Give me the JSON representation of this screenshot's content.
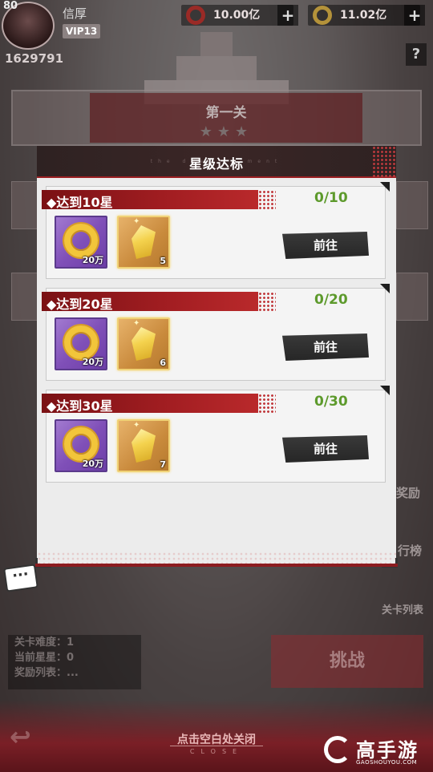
{
  "player": {
    "level": "80",
    "name": "信厚",
    "vip": "VIP13",
    "power": "1629791"
  },
  "resources": [
    {
      "icon": "ruby-coin-icon",
      "value": "10.00亿"
    },
    {
      "icon": "gold-coin-icon",
      "value": "11.02亿"
    }
  ],
  "background": {
    "stage_title": "第一关",
    "stage_stars": "★★★",
    "side_labels": [
      "奖励",
      "行榜",
      "关卡列表"
    ],
    "info_lines": [
      "关卡难度：1",
      "当前星星：0",
      "奖励列表：..."
    ],
    "challenge_label": "挑战"
  },
  "modal": {
    "title": "星级达标",
    "subtitle": "the deep ferment",
    "rows": [
      {
        "label": "◆达到10星",
        "progress": "0/10",
        "items": [
          {
            "icon": "gold-ring-icon",
            "qty": "20万"
          },
          {
            "icon": "gold-crystal-icon",
            "qty": "5"
          }
        ],
        "button": "前往"
      },
      {
        "label": "◆达到20星",
        "progress": "0/20",
        "items": [
          {
            "icon": "gold-ring-icon",
            "qty": "20万"
          },
          {
            "icon": "gold-crystal-icon",
            "qty": "6"
          }
        ],
        "button": "前往"
      },
      {
        "label": "◆达到30星",
        "progress": "0/30",
        "items": [
          {
            "icon": "gold-ring-icon",
            "qty": "20万"
          },
          {
            "icon": "gold-crystal-icon",
            "qty": "7"
          }
        ],
        "button": "前往"
      }
    ]
  },
  "close_hint": "点击空白处关闭",
  "close_sub": "CLOSE",
  "watermark": {
    "brand": "高手游",
    "url": "GAOSHOUYOU.COM"
  },
  "colors": {
    "accent_red": "#a31e22",
    "progress_green": "#5d9a2c",
    "header_dark": "#2e2222"
  }
}
